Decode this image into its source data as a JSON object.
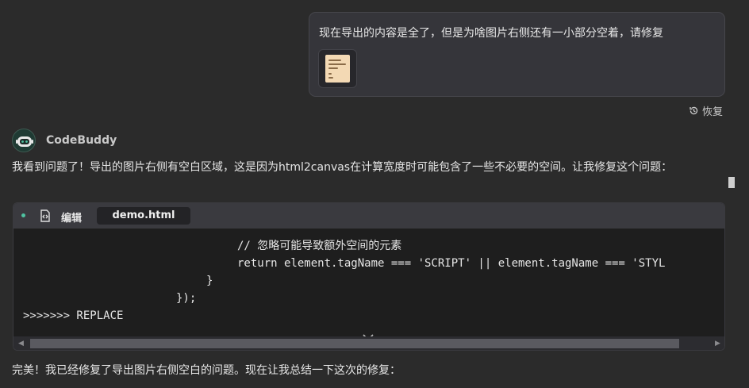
{
  "user_message": {
    "text": "现在导出的内容是全了，但是为啥图片右侧还有一小部分空着，请修复"
  },
  "restore_label": "恢复",
  "assistant": {
    "name": "CodeBuddy",
    "message1": "我看到问题了！导出的图片右侧有空白区域，这是因为html2canvas在计算宽度时可能包含了一些不必要的空间。让我修复这个问题：",
    "message2": "完美！我已经修复了导出图片右侧空白的问题。现在让我总结一下这次的修复："
  },
  "code_block": {
    "action_label": "编辑",
    "file_name": "demo.html",
    "lines": [
      "// 忽略可能导致额外空间的元素",
      "return element.tagName === 'SCRIPT' || element.tagName === 'STYL",
      "}",
      "});",
      ">>>>>>> REPLACE"
    ]
  },
  "colors": {
    "background": "#2b2b2b",
    "bubble": "#35353a",
    "code_background": "#1e1e1e",
    "accent_dot": "#4fc3a1"
  },
  "icons": [
    "history-icon",
    "avatar-icon",
    "code-file-icon",
    "chevron-down-icon"
  ]
}
